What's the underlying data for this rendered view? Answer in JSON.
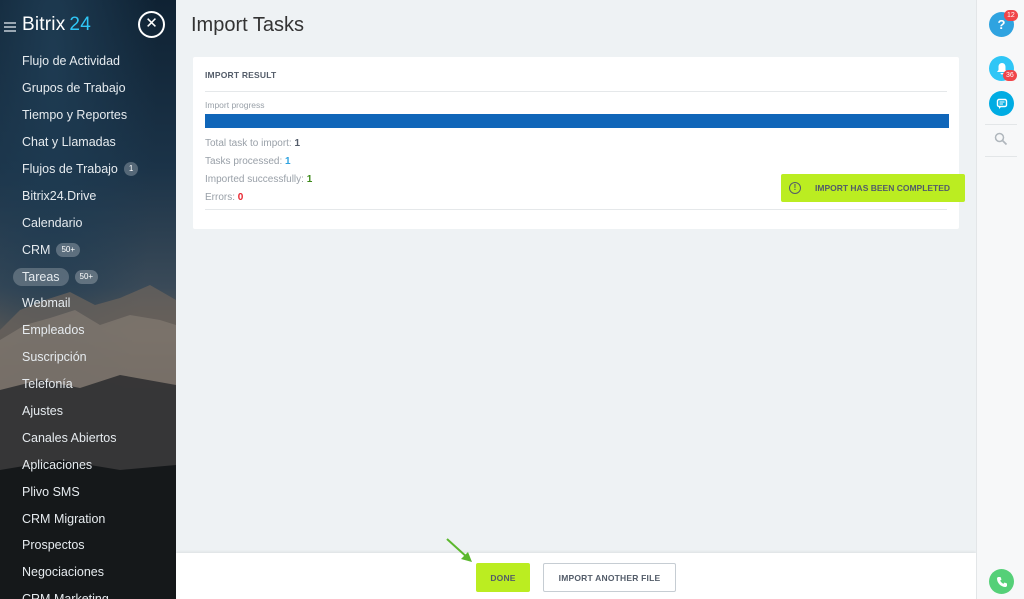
{
  "sidebar": {
    "logo_text": "Bitrix",
    "logo_number": "24",
    "items": [
      {
        "label": "Flujo de Actividad"
      },
      {
        "label": "Grupos de Trabajo"
      },
      {
        "label": "Tiempo y Reportes"
      },
      {
        "label": "Chat y Llamadas"
      },
      {
        "label": "Flujos de Trabajo",
        "counter": "1"
      },
      {
        "label": "Bitrix24.Drive"
      },
      {
        "label": "Calendario"
      },
      {
        "label": "CRM",
        "counter": "50+"
      },
      {
        "label": "Tareas",
        "counter": "50+",
        "active": true
      },
      {
        "label": "Webmail"
      },
      {
        "label": "Empleados"
      },
      {
        "label": "Suscripción"
      },
      {
        "label": "Telefonía"
      },
      {
        "label": "Ajustes"
      },
      {
        "label": "Canales Abiertos"
      },
      {
        "label": "Aplicaciones"
      },
      {
        "label": "Plivo SMS"
      },
      {
        "label": "CRM Migration"
      },
      {
        "label": "Prospectos"
      },
      {
        "label": "Negociaciones"
      },
      {
        "label": "CRM Marketing"
      }
    ]
  },
  "main": {
    "title": "Import Tasks",
    "card_title": "IMPORT RESULT",
    "progress_label": "Import progress",
    "progress_fraction": 1.0,
    "stats": {
      "total_label": "Total task to import: ",
      "total_value": "1",
      "processed_label": "Tasks processed: ",
      "processed_value": "1",
      "success_label": "Imported successfully: ",
      "success_value": "1",
      "errors_label": "Errors: ",
      "errors_value": "0"
    },
    "complete_badge": "IMPORT HAS BEEN COMPLETED"
  },
  "footer": {
    "done_label": "DONE",
    "import_another_label": "IMPORT ANOTHER FILE"
  },
  "right_panel": {
    "help_badge": "12",
    "bell_badge": "36"
  },
  "colors": {
    "accent_green": "#bbed21",
    "progress_blue": "#1066b9",
    "bitrix_cyan": "#2fc6f6"
  }
}
